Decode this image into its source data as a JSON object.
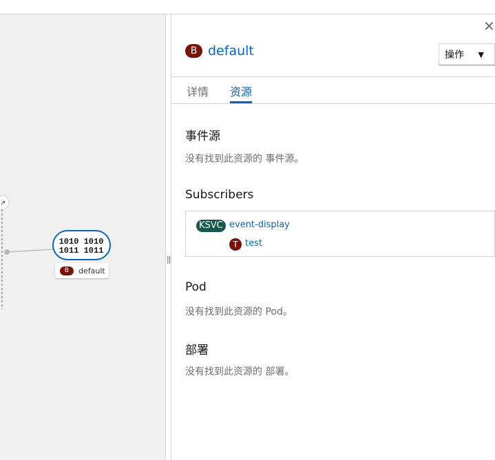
{
  "canvas": {
    "node_icon_text": "1010 1010",
    "node_label_badge": "B",
    "node_label": "default",
    "external_link_icon": "external-link-icon"
  },
  "panel": {
    "close_label": "✕",
    "title_badge": "B",
    "title": "default",
    "actions_label": "操作",
    "tabs": [
      {
        "label": "详情",
        "active": false
      },
      {
        "label": "资源",
        "active": true
      }
    ],
    "sections": {
      "event_sources": {
        "heading": "事件源",
        "empty": "没有找到此资源的 事件源。"
      },
      "subscribers": {
        "heading": "Subscribers",
        "service_badge": "KSVC",
        "service_name": "event-display",
        "trigger_badge": "T",
        "trigger_name": "test"
      },
      "pods": {
        "heading": "Pod",
        "empty": "没有找到此资源的 Pod。"
      },
      "deployments": {
        "heading": "部署",
        "empty": "没有找到此资源的 部署。"
      }
    }
  },
  "colors": {
    "broker_badge": "#7d1007",
    "ksvc_badge": "#155a4d",
    "link": "#0066cc",
    "node_border": "#0066cc"
  }
}
